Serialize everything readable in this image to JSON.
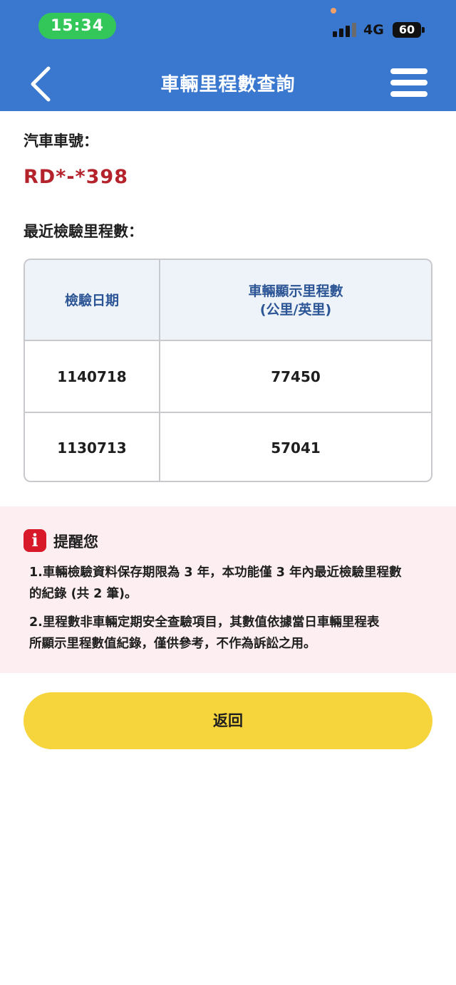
{
  "status_bar": {
    "time": "15:34",
    "network": "4G",
    "battery": "60"
  },
  "nav": {
    "title": "車輛里程數查詢",
    "back_icon": "chevron-left-icon",
    "menu_icon": "hamburger-menu-icon"
  },
  "vehicle": {
    "plate_label": "汽車車號：",
    "plate_value": "RD*-*398"
  },
  "mileage": {
    "section_label": "最近檢驗里程數：",
    "columns": [
      "檢驗日期",
      "車輛顯示里程數",
      "(公里/英里)"
    ],
    "rows": [
      {
        "date": "1140718",
        "mileage": "77450"
      },
      {
        "date": "1130713",
        "mileage": "57041"
      }
    ]
  },
  "notice": {
    "icon": "info-icon",
    "title": "提醒您",
    "item1_line1": "1.車輛檢驗資料保存期限為 3 年，本功能僅 3 年內最近檢驗里程數",
    "item1_line2": "的紀錄 (共 2 筆)。",
    "item2_line1": "2.里程數非車輛定期安全查驗項目，其數值依據當日車輛里程表",
    "item2_line2": "所顯示里程數值紀錄，僅供參考，不作為訴訟之用。"
  },
  "actions": {
    "return_label": "返回"
  },
  "colors": {
    "header_blue": "#3a78cf",
    "plate_red": "#b4232b",
    "notice_bg": "#fdeff1",
    "button_yellow": "#f6d43c"
  }
}
